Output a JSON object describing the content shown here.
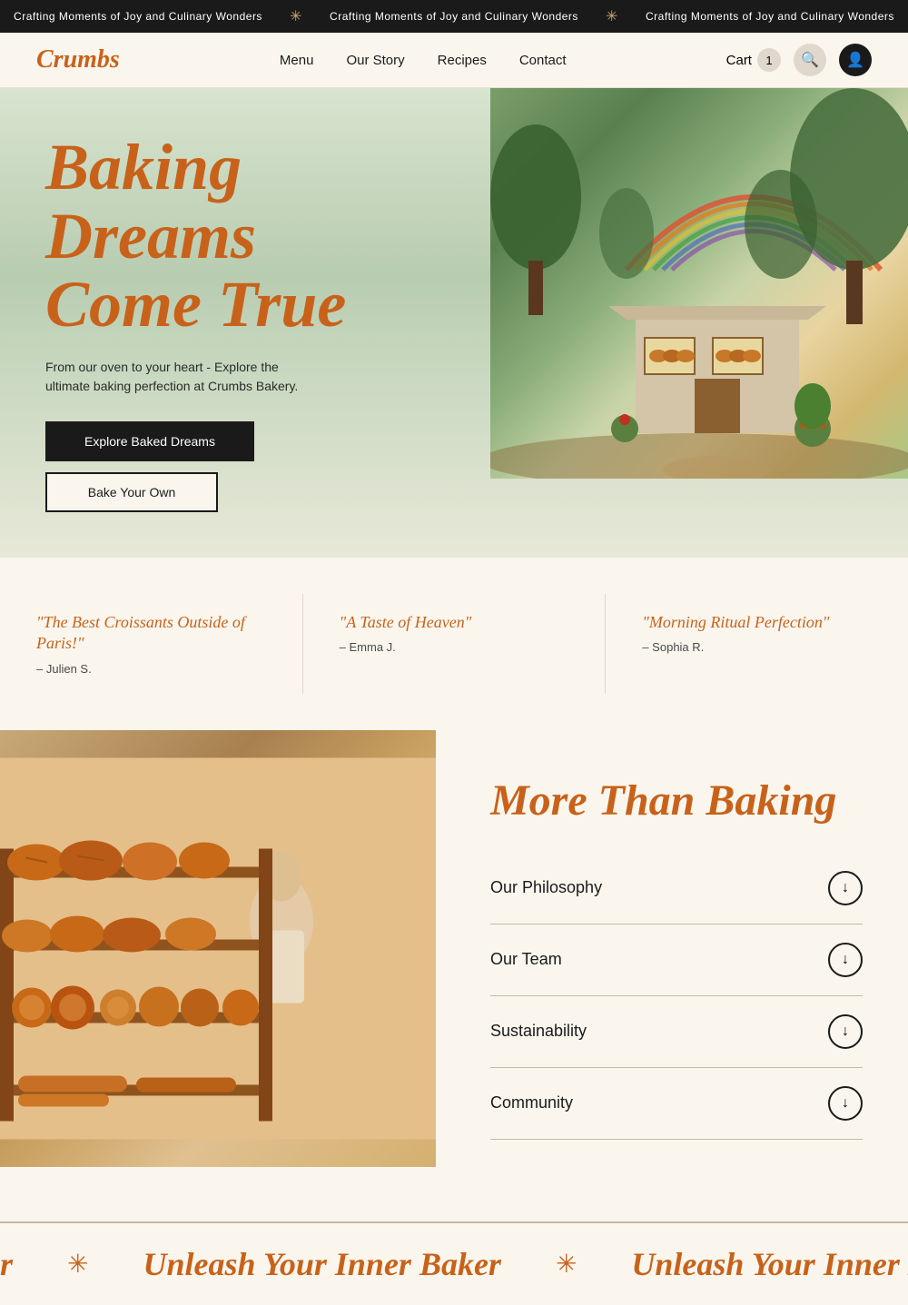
{
  "announcement": {
    "text1": "Crafting Moments of Joy and Culinary Wonders",
    "text2": "Crafting Moments of Joy and Culinary Wonders",
    "text3": "Crafting Moments of Joy and Culinary Wonders"
  },
  "header": {
    "logo": "Crumbs",
    "nav": {
      "menu": "Menu",
      "our_story": "Our Story",
      "recipes": "Recipes",
      "contact": "Contact"
    },
    "cart_label": "Cart",
    "cart_count": "1"
  },
  "hero": {
    "title_line1": "Baking",
    "title_line2": "Dreams",
    "title_line3": "Come True",
    "subtitle": "From our oven to your heart - Explore the ultimate baking perfection at Crumbs Bakery.",
    "btn_primary": "Explore Baked Dreams",
    "btn_secondary": "Bake Your Own"
  },
  "testimonials": [
    {
      "quote": "\"The Best Croissants Outside of Paris!\"",
      "author": "– Julien S."
    },
    {
      "quote": "\"A Taste of Heaven\"",
      "author": "– Emma J."
    },
    {
      "quote": "\"Morning Ritual Perfection\"",
      "author": "– Sophia R."
    }
  ],
  "more_baking": {
    "title": "More Than Baking",
    "accordion": [
      {
        "label": "Our Philosophy"
      },
      {
        "label": "Our Team"
      },
      {
        "label": "Sustainability"
      },
      {
        "label": "Community"
      }
    ]
  },
  "marquee": {
    "text": "Unleash Your Inner Baker"
  }
}
